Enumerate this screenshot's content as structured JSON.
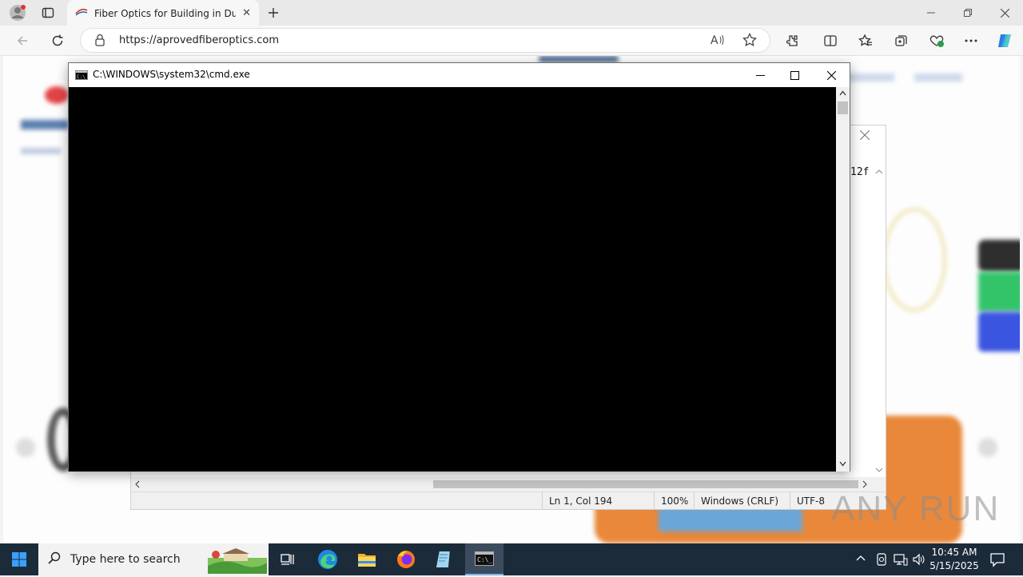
{
  "browser": {
    "tab_title": "Fiber Optics for Building in Dubai",
    "url": "https://aprovedfiberoptics.com"
  },
  "cmd": {
    "title": "C:\\WINDOWS\\system32\\cmd.exe"
  },
  "notepad": {
    "visible_text": "12f",
    "status": {
      "position": "Ln 1, Col 194",
      "zoom": "100%",
      "line_ending": "Windows (CRLF)",
      "encoding": "UTF-8"
    }
  },
  "taskbar": {
    "search_placeholder": "Type here to search",
    "time": "10:45 AM",
    "date": "5/15/2025"
  },
  "watermark": "ANY RUN"
}
